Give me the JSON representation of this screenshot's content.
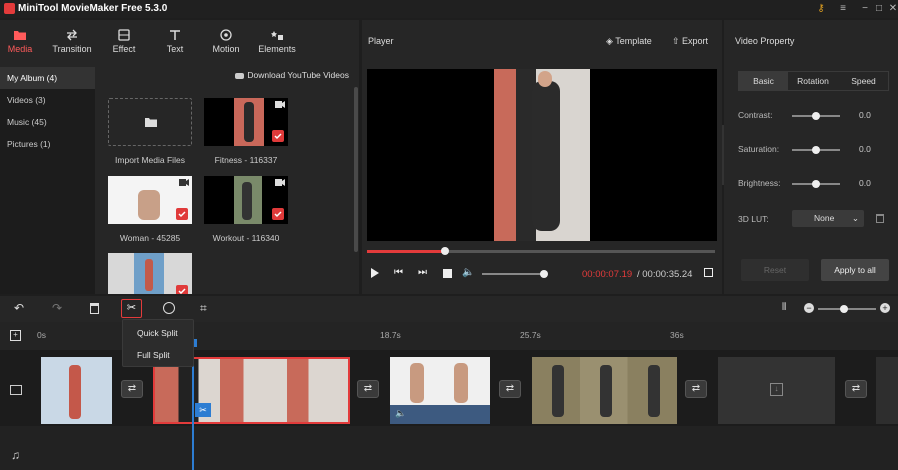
{
  "app": {
    "title": "MiniTool MovieMaker Free 5.3.0"
  },
  "toolbar": {
    "items": [
      {
        "label": "Media",
        "icon": "folder-icon"
      },
      {
        "label": "Transition",
        "icon": "transition-icon"
      },
      {
        "label": "Effect",
        "icon": "effect-icon"
      },
      {
        "label": "Text",
        "icon": "text-icon"
      },
      {
        "label": "Motion",
        "icon": "motion-icon"
      },
      {
        "label": "Elements",
        "icon": "elements-icon"
      }
    ]
  },
  "sidebar": {
    "items": [
      {
        "label": "My Album (4)"
      },
      {
        "label": "Videos (3)"
      },
      {
        "label": "Music (45)"
      },
      {
        "label": "Pictures (1)"
      }
    ]
  },
  "library": {
    "download_label": "Download YouTube Videos",
    "import_label": "Import Media Files",
    "items": [
      {
        "label": "Fitness - 116337"
      },
      {
        "label": "Woman - 45285"
      },
      {
        "label": "Workout - 116340"
      }
    ]
  },
  "player": {
    "title": "Player",
    "template_label": "Template",
    "export_label": "Export",
    "current_time": "00:00:07.19",
    "total_time": " / 00:00:35.24",
    "progress_fraction": 0.22
  },
  "property": {
    "title": "Video Property",
    "tabs": [
      "Basic",
      "Rotation",
      "Speed"
    ],
    "contrast_label": "Contrast:",
    "contrast_value": "0.0",
    "saturation_label": "Saturation:",
    "saturation_value": "0.0",
    "brightness_label": "Brightness:",
    "brightness_value": "0.0",
    "lut_label": "3D LUT:",
    "lut_value": "None",
    "reset_label": "Reset",
    "apply_label": "Apply to all"
  },
  "timeline": {
    "ruler": [
      "0s",
      "18.7s",
      "25.7s",
      "36s"
    ]
  },
  "split_menu": {
    "quick": "Quick Split",
    "full": "Full Split"
  },
  "colors": {
    "accent": "#e33b3b",
    "playhead": "#2d7dd2"
  }
}
